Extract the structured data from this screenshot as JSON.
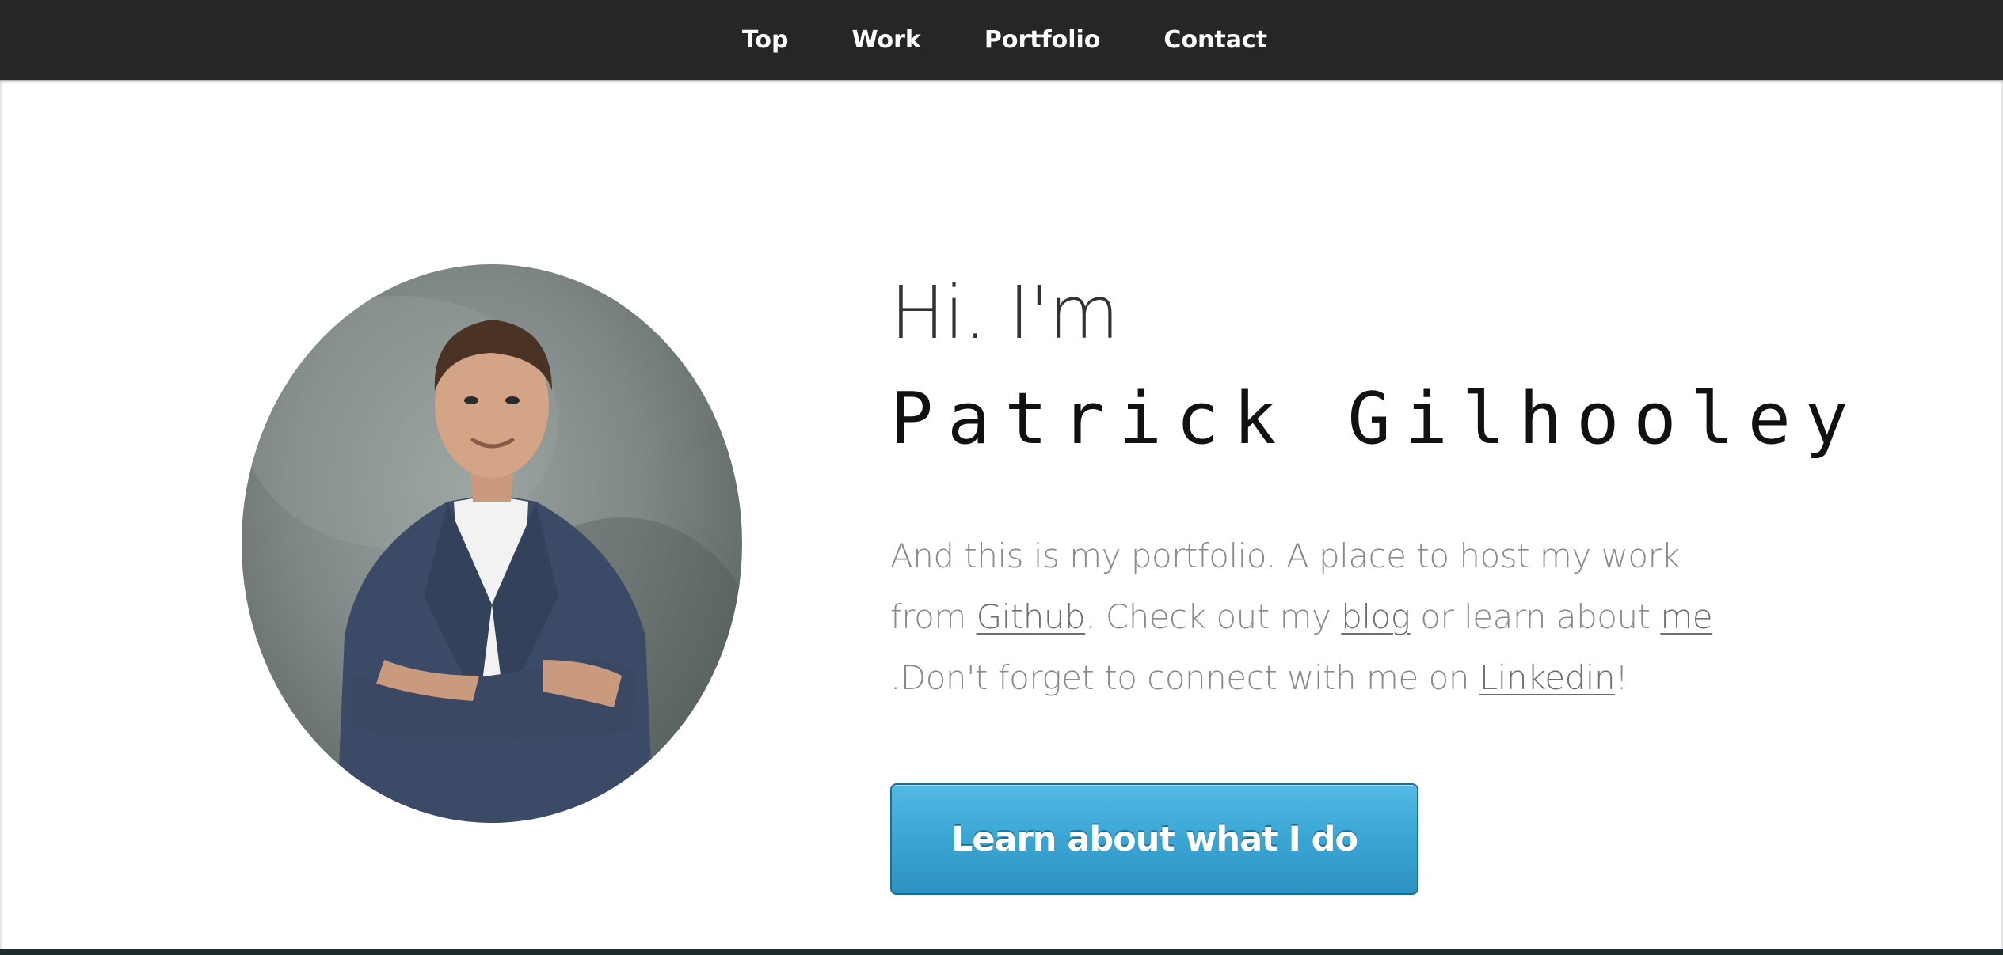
{
  "nav": {
    "items": [
      {
        "label": "Top"
      },
      {
        "label": "Work"
      },
      {
        "label": "Portfolio"
      },
      {
        "label": "Contact"
      }
    ]
  },
  "hero": {
    "greeting": "Hi. I'm",
    "name": "Patrick Gilhooley",
    "intro": {
      "part1": "And this is my portfolio. A place to host my work from ",
      "github_link": "Github",
      "part2": ". Check out my ",
      "blog_link": "blog",
      "part3": " or learn about ",
      "me_link": "me",
      "part4": " .Don't forget to connect with me on ",
      "linkedin_link": "Linkedin",
      "part5": "!"
    },
    "cta_label": "Learn about what I do"
  },
  "colors": {
    "navbar": "#262626",
    "button": "#3aa5d4",
    "text_muted": "#8a8a8a"
  },
  "icons": {
    "avatar": "profile-photo"
  }
}
